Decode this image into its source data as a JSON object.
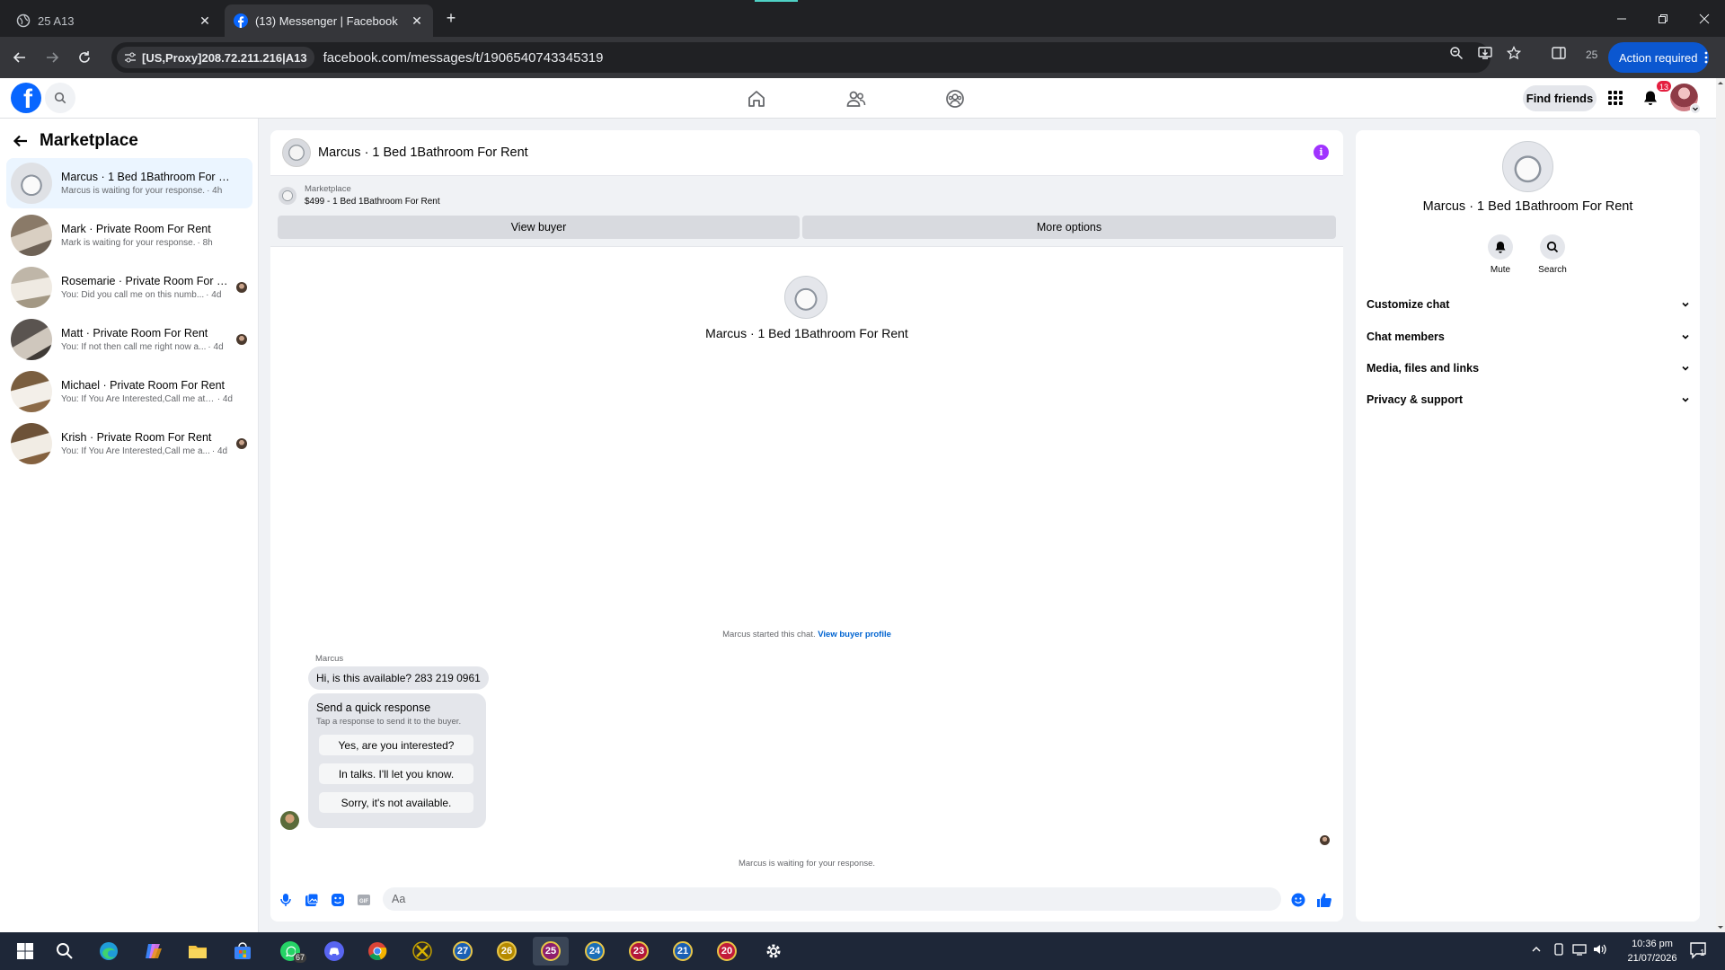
{
  "browser": {
    "tabs": [
      {
        "title": "25 A13",
        "active": false
      },
      {
        "title": "(13) Messenger | Facebook",
        "active": true
      }
    ],
    "proxy_label": "[US,Proxy]208.72.211.216|A13",
    "url": "facebook.com/messages/t/1906540743345319",
    "ext_count": "25",
    "action_required": "Action required"
  },
  "fb_header": {
    "find_friends": "Find friends",
    "notification_count": "13"
  },
  "sidebar": {
    "title": "Marketplace",
    "conversations": [
      {
        "name": "Marcus · 1 Bed 1Bathroom For Rent",
        "preview": "Marcus is waiting for your response.",
        "time": "· 4h",
        "selected": true,
        "seen": false
      },
      {
        "name": "Mark · Private Room For Rent",
        "preview": "Mark is waiting for your response.",
        "time": "· 8h",
        "selected": false,
        "seen": false
      },
      {
        "name": "Rosemarie · Private Room For R...",
        "preview": "You: Did you call me on this numb...",
        "time": "· 4d",
        "selected": false,
        "seen": true
      },
      {
        "name": "Matt · Private Room For Rent",
        "preview": "You: If not then call me right now a...",
        "time": "· 4d",
        "selected": false,
        "seen": true
      },
      {
        "name": "Michael · Private Room For Rent",
        "preview": "You: If You Are Interested,Call me at t...",
        "time": "· 4d",
        "selected": false,
        "seen": false
      },
      {
        "name": "Krish · Private Room For Rent",
        "preview": "You: If You Are Interested,Call me a...",
        "time": "· 4d",
        "selected": false,
        "seen": true
      }
    ]
  },
  "chat": {
    "title": "Marcus · 1 Bed 1Bathroom For Rent",
    "listing_source": "Marketplace",
    "listing_line": "$499 - 1 Bed 1Bathroom For Rent",
    "view_buyer": "View buyer",
    "more_options": "More options",
    "profile_name": "Marcus · 1 Bed 1Bathroom For Rent",
    "started_text": "Marcus started this chat.",
    "view_buyer_profile": "View buyer profile",
    "sender": "Marcus",
    "message": "Hi, is this available? 283 219 0961",
    "quick_response_title": "Send a quick response",
    "quick_response_sub": "Tap a response to send it to the buyer.",
    "quick_responses": [
      "Yes, are you interested?",
      "In talks. I'll let you know.",
      "Sorry, it's not available."
    ],
    "waiting_text": "Marcus is waiting for your response.",
    "input_placeholder": "Aa"
  },
  "details": {
    "name": "Marcus · 1 Bed 1Bathroom For Rent",
    "mute": "Mute",
    "search": "Search",
    "sections": [
      "Customize chat",
      "Chat members",
      "Media, files and links",
      "Privacy & support"
    ]
  },
  "taskbar": {
    "whatsapp_badge": "67",
    "profiles": [
      "27",
      "26",
      "25",
      "24",
      "23",
      "21",
      "20"
    ],
    "active_profile": "25",
    "time": "10:36 pm",
    "date": "21/07/2026",
    "notification_count": "1"
  },
  "colors": {
    "facebook_blue": "#0866ff",
    "selected_conversation": "#ebf5ff",
    "info_purple": "#a033ff",
    "action_blue": "#0b57d0",
    "badge_red": "#e41e3f"
  }
}
